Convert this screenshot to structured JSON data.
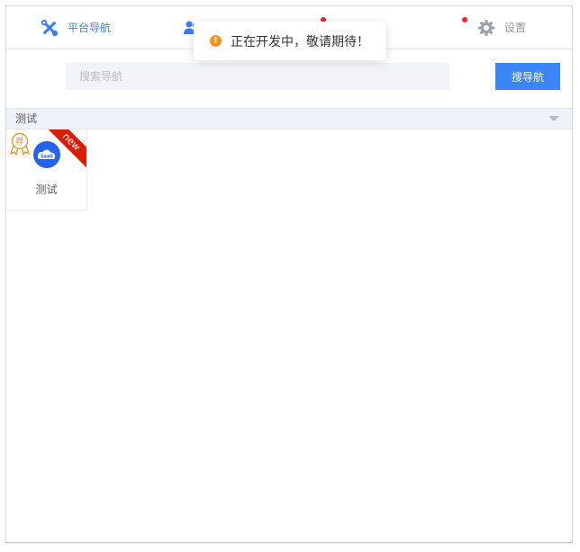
{
  "nav": {
    "items": [
      {
        "label": "平台导航",
        "icon": "tools-icon",
        "active": true
      },
      {
        "label": "",
        "icon": "users-icon",
        "active": false
      },
      {
        "label": "",
        "icon": "",
        "active": false,
        "dot": true
      },
      {
        "label": "设置",
        "icon": "gear-icon",
        "active": false,
        "dot": true
      }
    ]
  },
  "toast": {
    "icon": "warning-icon",
    "message": "正在开发中，敬请期待！"
  },
  "search": {
    "placeholder": "搜索导航",
    "button_label": "搜导航"
  },
  "category": {
    "label": "测试",
    "caret": "caret-down-icon"
  },
  "cards": [
    {
      "label": "测试",
      "icon_text": "SaaS",
      "ribbon": "new",
      "badge_text": "荐"
    }
  ],
  "colors": {
    "accent": "#3b85f6",
    "ribbon": "#d81e06",
    "warning": "#f7931e",
    "badge": "#e09a2a",
    "category_bg": "#eef2f9"
  }
}
